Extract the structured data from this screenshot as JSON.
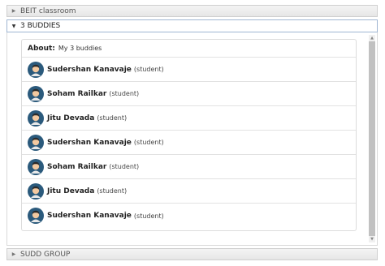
{
  "accordion": {
    "groups": [
      {
        "label": "BEIT classroom",
        "expanded": false
      },
      {
        "label": "3 BUDDIES",
        "expanded": true
      },
      {
        "label": "SUDD GROUP",
        "expanded": false
      }
    ]
  },
  "group_panel": {
    "about_label": "About:",
    "about_text": "My 3 buddies",
    "members": [
      {
        "name": "Sudershan Kanavaje",
        "role": "(student)"
      },
      {
        "name": "Soham Railkar",
        "role": "(student)"
      },
      {
        "name": "Jitu Devada",
        "role": "(student)"
      },
      {
        "name": "Sudershan Kanavaje",
        "role": "(student)"
      },
      {
        "name": "Soham Railkar",
        "role": "(student)"
      },
      {
        "name": "Jitu Devada",
        "role": "(student)"
      },
      {
        "name": "Sudershan Kanavaje",
        "role": "(student)"
      }
    ]
  },
  "colors": {
    "avatar_bg": "#2b5a7c",
    "avatar_skin": "#f3c9a0",
    "avatar_hair": "#2b2b2b",
    "open_header_border": "#9fb5d2"
  },
  "icons": {
    "collapsed": "caret-right-icon",
    "expanded": "caret-down-icon",
    "member": "user-avatar-icon"
  }
}
